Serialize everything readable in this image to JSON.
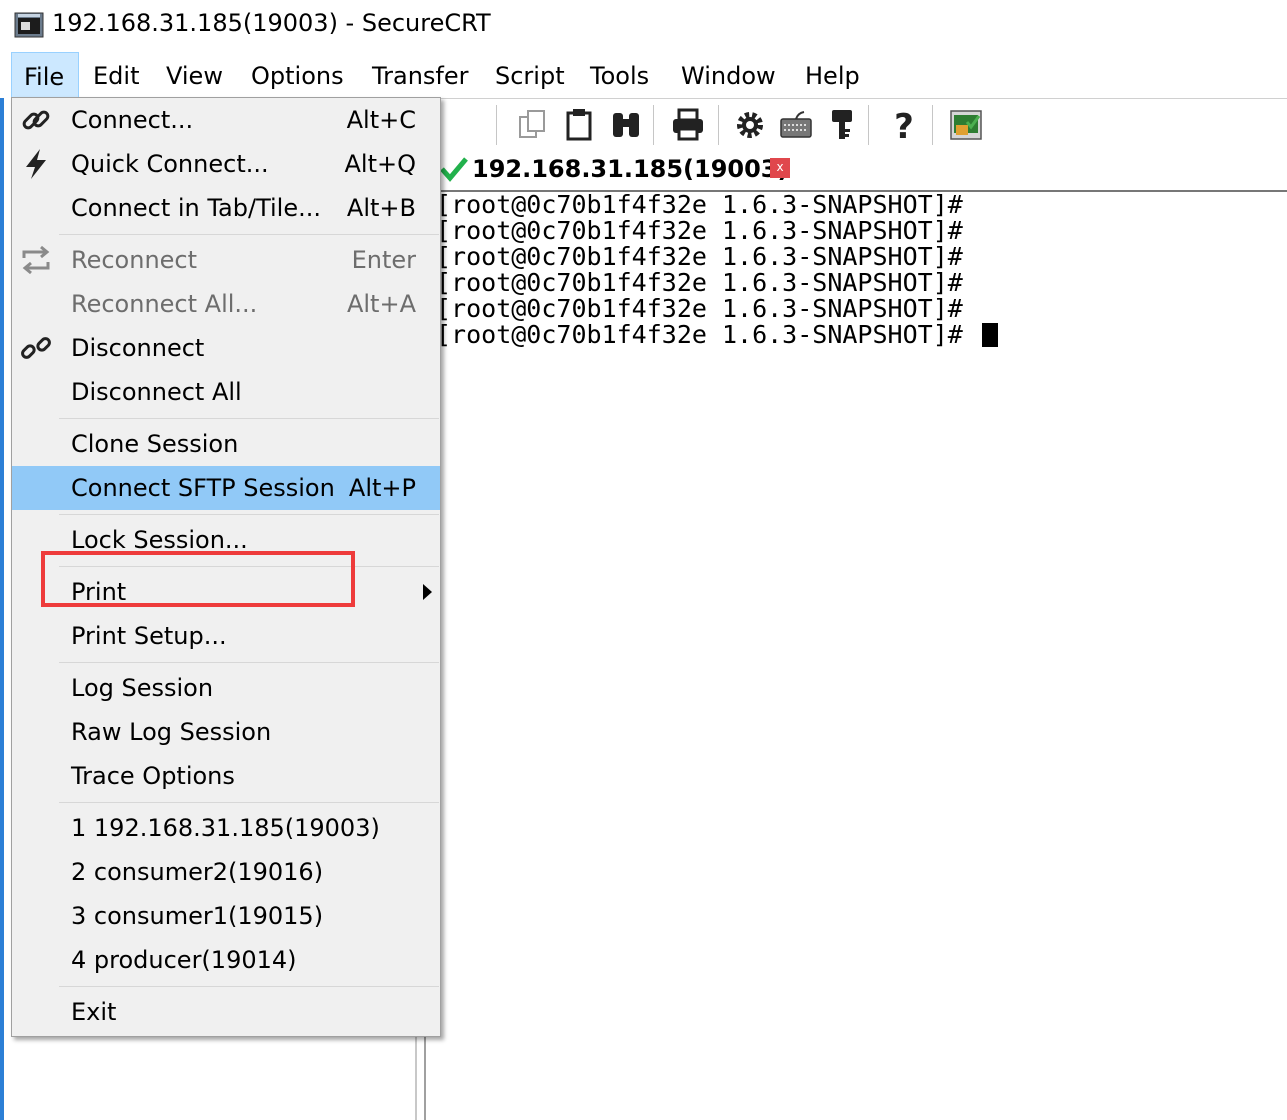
{
  "window": {
    "title": "192.168.31.185(19003) - SecureCRT"
  },
  "menubar": {
    "items": [
      "File",
      "Edit",
      "View",
      "Options",
      "Transfer",
      "Script",
      "Tools",
      "Window",
      "Help"
    ],
    "active": "File"
  },
  "tab": {
    "label": "192.168.31.185(19003)",
    "status": "connected",
    "close": "x"
  },
  "terminal": {
    "lines": [
      "[root@0c70b1f4f32e 1.6.3-SNAPSHOT]#",
      "[root@0c70b1f4f32e 1.6.3-SNAPSHOT]#",
      "[root@0c70b1f4f32e 1.6.3-SNAPSHOT]#",
      "[root@0c70b1f4f32e 1.6.3-SNAPSHOT]#",
      "[root@0c70b1f4f32e 1.6.3-SNAPSHOT]#",
      "[root@0c70b1f4f32e 1.6.3-SNAPSHOT]# "
    ]
  },
  "file_menu": {
    "items": [
      {
        "label": "Connect...",
        "shortcut": "Alt+C",
        "icon": "link-icon"
      },
      {
        "label": "Quick Connect...",
        "shortcut": "Alt+Q",
        "icon": "lightning-icon"
      },
      {
        "label": "Connect in Tab/Tile...",
        "shortcut": "Alt+B"
      },
      {
        "label": "Reconnect",
        "shortcut": "Enter",
        "icon": "reconnect-icon",
        "disabled": true
      },
      {
        "label": "Reconnect All...",
        "shortcut": "Alt+A",
        "disabled": true
      },
      {
        "label": "Disconnect",
        "shortcut": "",
        "icon": "broken-link-icon"
      },
      {
        "label": "Disconnect All",
        "shortcut": ""
      },
      {
        "label": "Clone Session",
        "shortcut": ""
      },
      {
        "label": "Connect SFTP Session",
        "shortcut": "Alt+P",
        "highlighted": true
      },
      {
        "label": "Lock Session...",
        "shortcut": ""
      },
      {
        "label": "Print",
        "shortcut": "",
        "submenu": true
      },
      {
        "label": "Print Setup...",
        "shortcut": ""
      },
      {
        "label": "Log Session",
        "shortcut": ""
      },
      {
        "label": "Raw Log Session",
        "shortcut": ""
      },
      {
        "label": "Trace Options",
        "shortcut": ""
      },
      {
        "label": "1 192.168.31.185(19003)",
        "shortcut": ""
      },
      {
        "label": "2 consumer2(19016)",
        "shortcut": ""
      },
      {
        "label": "3 consumer1(19015)",
        "shortcut": ""
      },
      {
        "label": "4 producer(19014)",
        "shortcut": ""
      },
      {
        "label": "Exit",
        "shortcut": ""
      }
    ]
  },
  "toolbar": {
    "icons": [
      "copy-icon",
      "paste-icon",
      "find-icon",
      "print-icon",
      "settings-icon",
      "keymap-icon",
      "key-icon",
      "help-icon",
      "sftp-icon"
    ]
  },
  "colors": {
    "menu_bg": "#f0f0f0",
    "highlight": "#91c9f7",
    "annotation_box": "#ee3b3b",
    "connected_check": "#22b14c",
    "tab_close": "#e0474c"
  }
}
